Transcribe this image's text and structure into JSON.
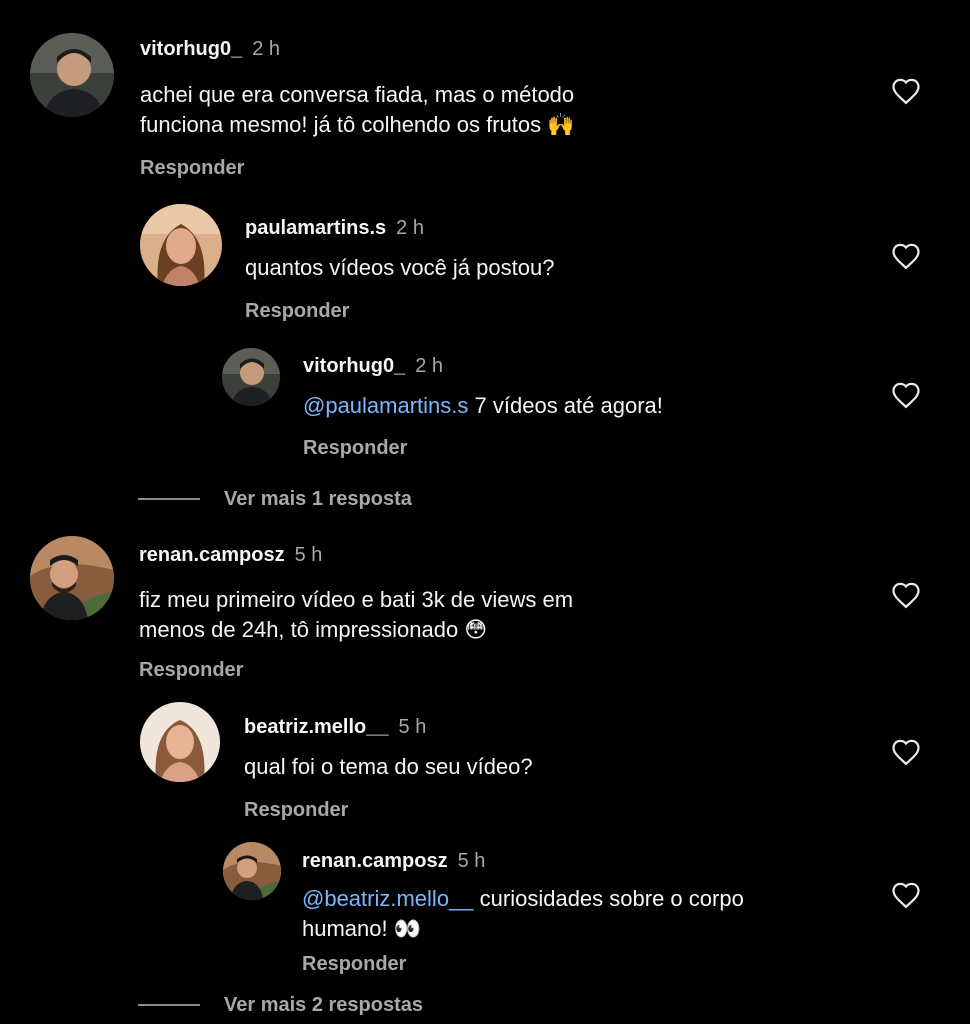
{
  "comments": [
    {
      "username": "vitorhug0_",
      "time": "2 h",
      "line1": "achei que era conversa fiada, mas o método",
      "line2": "funciona mesmo! já tô colhendo os frutos",
      "emoji": "🙌",
      "reply_label": "Responder"
    },
    {
      "username": "paulamartins.s",
      "time": "2 h",
      "text": "quantos vídeos você já postou?",
      "reply_label": "Responder"
    },
    {
      "username": "vitorhug0_",
      "time": "2 h",
      "mention": "@paulamartins.s",
      "text": "7 vídeos até agora!",
      "reply_label": "Responder"
    },
    {
      "username": "renan.camposz",
      "time": "5 h",
      "line1": "fiz meu primeiro vídeo e bati 3k de views em",
      "line2": "menos de 24h, tô impressionado",
      "emoji": "😳",
      "reply_label": "Responder"
    },
    {
      "username": "beatriz.mello__",
      "time": "5 h",
      "text": "qual foi o tema do seu vídeo?",
      "reply_label": "Responder"
    },
    {
      "username": "renan.camposz",
      "time": "5 h",
      "mention": "@beatriz.mello__",
      "line1": "curiosidades sobre o corpo",
      "line2": "humano!",
      "emoji": "👀",
      "reply_label": "Responder"
    }
  ],
  "view_more": [
    {
      "label": "Ver mais 1 resposta"
    },
    {
      "label": "Ver mais 2 respostas"
    }
  ],
  "icons": {
    "like": "heart-outline-icon"
  },
  "colors": {
    "background": "#000000",
    "text": "#f5f5f5",
    "secondary": "#a8a8a8",
    "mention": "#7ab7ff"
  }
}
